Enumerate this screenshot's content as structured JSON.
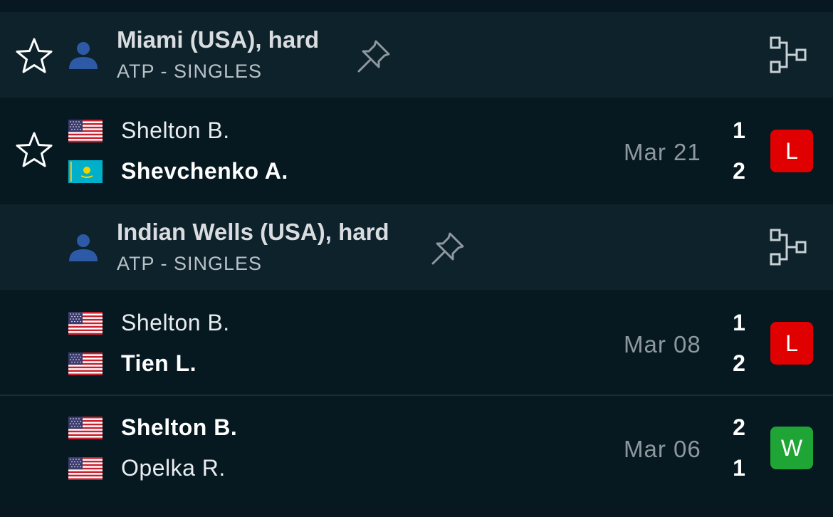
{
  "colors": {
    "background": "#081820",
    "tournament_row": "#0e222b",
    "match_row": "#061820",
    "loss_badge": "#e00000",
    "win_badge": "#1fa535",
    "person_icon": "#2d5aa6"
  },
  "tournaments": [
    {
      "name": "Miami (USA), hard",
      "category": "ATP - SINGLES",
      "icons": [
        "star-icon",
        "person-icon",
        "pin-icon",
        "bracket-icon"
      ],
      "matches": [
        {
          "home": {
            "name": "Shelton B.",
            "flag": "usa-flag-icon",
            "score": "1"
          },
          "away": {
            "name": "Shevchenko A.",
            "flag": "kazakhstan-flag-icon",
            "score": "2"
          },
          "date": "Mar 21",
          "result": "L"
        }
      ]
    },
    {
      "name": "Indian Wells (USA), hard",
      "category": "ATP - SINGLES",
      "icons": [
        "person-icon",
        "pin-icon",
        "bracket-icon"
      ],
      "matches": [
        {
          "home": {
            "name": "Shelton B.",
            "flag": "usa-flag-icon",
            "score": "1"
          },
          "away": {
            "name": "Tien L.",
            "flag": "usa-flag-icon",
            "score": "2"
          },
          "date": "Mar 08",
          "result": "L"
        },
        {
          "home": {
            "name": "Shelton B.",
            "flag": "usa-flag-icon",
            "score": "2"
          },
          "away": {
            "name": "Opelka R.",
            "flag": "usa-flag-icon",
            "score": "1"
          },
          "date": "Mar 06",
          "result": "W"
        }
      ]
    }
  ]
}
